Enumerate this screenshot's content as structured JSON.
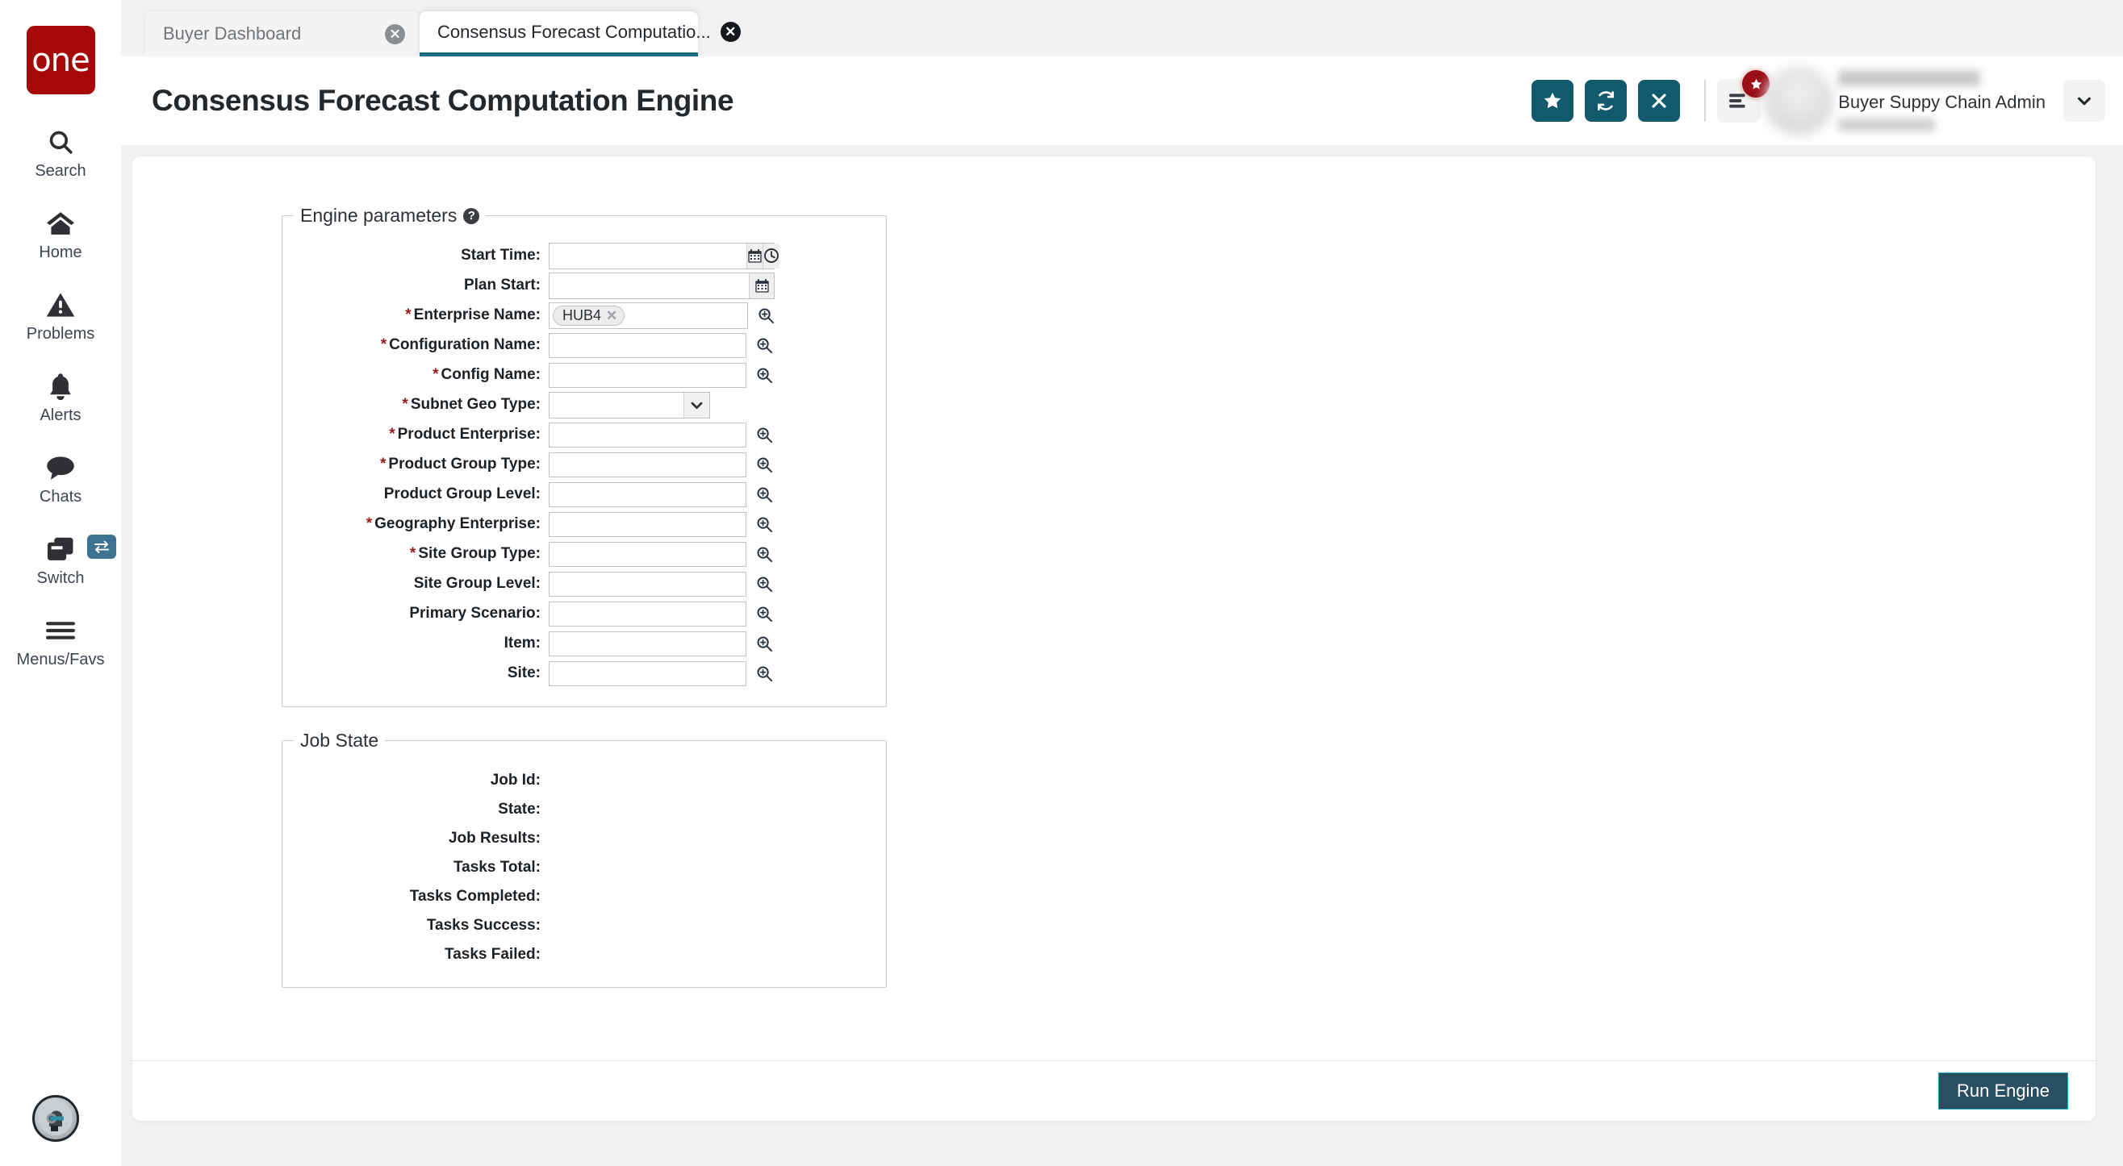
{
  "brand": {
    "logo_text": "one",
    "logo_color": "#a60808"
  },
  "rail": {
    "items": [
      {
        "label": "Search",
        "icon": "search-icon"
      },
      {
        "label": "Home",
        "icon": "home-icon"
      },
      {
        "label": "Problems",
        "icon": "warning-triangle-icon"
      },
      {
        "label": "Alerts",
        "icon": "bell-icon"
      },
      {
        "label": "Chats",
        "icon": "chat-bubble-icon"
      },
      {
        "label": "Switch",
        "icon": "windows-stack-icon",
        "badge_icon": "swap-arrows-icon"
      },
      {
        "label": "Menus/Favs",
        "icon": "hamburger-icon"
      }
    ],
    "assistant_avatar": "robot-avatar-icon"
  },
  "tabs": [
    {
      "label": "Buyer Dashboard",
      "active": false,
      "close_icon": "close-circle-icon"
    },
    {
      "label": "Consensus Forecast Computatio...",
      "active": true,
      "close_icon": "close-circle-icon"
    }
  ],
  "header": {
    "title": "Consensus Forecast Computation Engine",
    "actions": [
      {
        "name": "favorite-button",
        "icon": "star-icon"
      },
      {
        "name": "refresh-button",
        "icon": "refresh-icon"
      },
      {
        "name": "close-button",
        "icon": "x-icon"
      }
    ],
    "menu_button": {
      "icon": "list-menu-icon",
      "badge_icon": "star-icon"
    },
    "user": {
      "role": "Buyer Suppy Chain Admin",
      "caret_icon": "chevron-down-icon"
    },
    "accent_color": "#11596c"
  },
  "engine_parameters": {
    "legend": "Engine parameters",
    "help_icon": "help-circle-icon",
    "fields": [
      {
        "label": "Start Time:",
        "required": false,
        "type": "datetime",
        "value": "",
        "addons": [
          "calendar-icon",
          "clock-icon"
        ]
      },
      {
        "label": "Plan Start:",
        "required": false,
        "type": "date",
        "value": "",
        "addons": [
          "calendar-icon"
        ]
      },
      {
        "label": "Enterprise Name:",
        "required": true,
        "type": "chips",
        "chips": [
          {
            "text": "HUB4",
            "remove_icon": "x-icon"
          }
        ],
        "lookup_icon": "magnifier-plus-icon"
      },
      {
        "label": "Configuration Name:",
        "required": true,
        "type": "lookup",
        "value": "",
        "lookup_icon": "magnifier-plus-icon"
      },
      {
        "label": "Config Name:",
        "required": true,
        "type": "lookup",
        "value": "",
        "lookup_icon": "magnifier-plus-icon"
      },
      {
        "label": "Subnet Geo Type:",
        "required": true,
        "type": "select",
        "value": "",
        "arrow_icon": "chevron-down-icon"
      },
      {
        "label": "Product Enterprise:",
        "required": true,
        "type": "lookup",
        "value": "",
        "lookup_icon": "magnifier-plus-icon"
      },
      {
        "label": "Product Group Type:",
        "required": true,
        "type": "lookup",
        "value": "",
        "lookup_icon": "magnifier-plus-icon"
      },
      {
        "label": "Product Group Level:",
        "required": false,
        "type": "lookup",
        "value": "",
        "lookup_icon": "magnifier-plus-icon"
      },
      {
        "label": "Geography Enterprise:",
        "required": true,
        "type": "lookup",
        "value": "",
        "lookup_icon": "magnifier-plus-icon"
      },
      {
        "label": "Site Group Type:",
        "required": true,
        "type": "lookup",
        "value": "",
        "lookup_icon": "magnifier-plus-icon"
      },
      {
        "label": "Site Group Level:",
        "required": false,
        "type": "lookup",
        "value": "",
        "lookup_icon": "magnifier-plus-icon"
      },
      {
        "label": "Primary Scenario:",
        "required": false,
        "type": "lookup",
        "value": "",
        "lookup_icon": "magnifier-plus-icon"
      },
      {
        "label": "Item:",
        "required": false,
        "type": "lookup",
        "value": "",
        "lookup_icon": "magnifier-plus-icon"
      },
      {
        "label": "Site:",
        "required": false,
        "type": "lookup",
        "value": "",
        "lookup_icon": "magnifier-plus-icon"
      }
    ]
  },
  "job_state": {
    "legend": "Job State",
    "rows": [
      {
        "label": "Job Id:",
        "value": ""
      },
      {
        "label": "State:",
        "value": ""
      },
      {
        "label": "Job Results:",
        "value": ""
      },
      {
        "label": "Tasks Total:",
        "value": ""
      },
      {
        "label": "Tasks Completed:",
        "value": ""
      },
      {
        "label": "Tasks Success:",
        "value": ""
      },
      {
        "label": "Tasks Failed:",
        "value": ""
      }
    ]
  },
  "footer": {
    "run_label": "Run Engine",
    "run_color": "#2a4f63"
  }
}
